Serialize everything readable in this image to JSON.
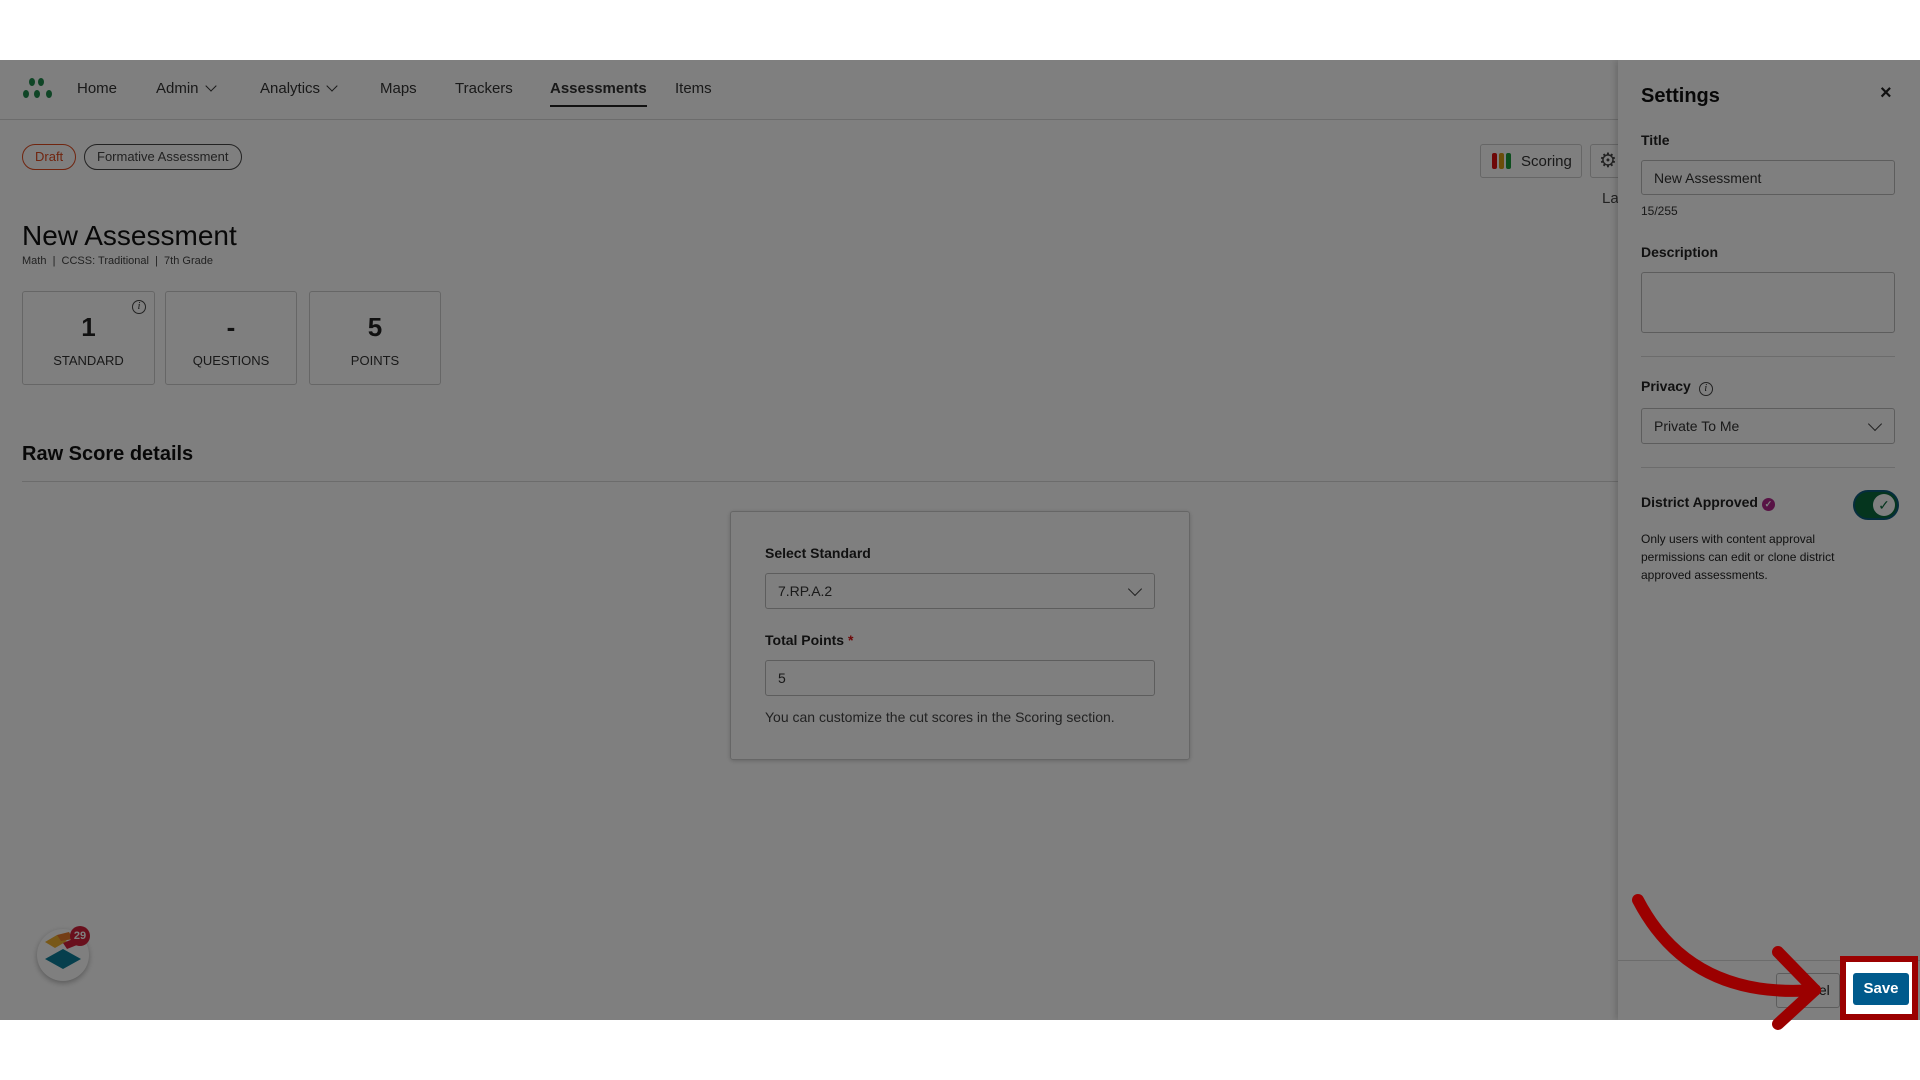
{
  "nav": {
    "items": [
      {
        "label": "Home"
      },
      {
        "label": "Admin"
      },
      {
        "label": "Analytics"
      },
      {
        "label": "Maps"
      },
      {
        "label": "Trackers"
      },
      {
        "label": "Assessments"
      },
      {
        "label": "Items"
      }
    ],
    "active": "Assessments"
  },
  "tags": {
    "status": "Draft",
    "type": "Formative Assessment"
  },
  "header": {
    "title": "New Assessment",
    "meta": "Math  |  CCSS: Traditional  |  7th Grade",
    "scoring_label": "Scoring",
    "partial_label": "La"
  },
  "stats": [
    {
      "value": "1",
      "label": "STANDARD"
    },
    {
      "value": "-",
      "label": "QUESTIONS"
    },
    {
      "value": "5",
      "label": "POINTS"
    }
  ],
  "section": {
    "title": "Raw Score details"
  },
  "form": {
    "standard_label": "Select Standard",
    "standard_value": "7.RP.A.2",
    "points_label": "Total Points",
    "required_mark": "*",
    "points_value": "5",
    "help": "You can customize the cut scores in the Scoring section."
  },
  "settings": {
    "title": "Settings",
    "title_label": "Title",
    "title_value": "New Assessment",
    "char_count": "15/255",
    "description_label": "Description",
    "description_value": "",
    "privacy_label": "Privacy",
    "privacy_value": "Private To Me",
    "district_label": "District Approved",
    "district_on": true,
    "district_help": "Only users with content approval permissions can edit or clone district approved assessments.",
    "cancel_label": "Cancel",
    "save_label": "Save"
  },
  "notification_count": "29",
  "colors": {
    "overlay": "rgba(0,0,0,0.5)",
    "save": "#005a8c",
    "highlight": "#9b0000",
    "toggle": "#0a6b3d",
    "draft": "#e04a1f"
  }
}
